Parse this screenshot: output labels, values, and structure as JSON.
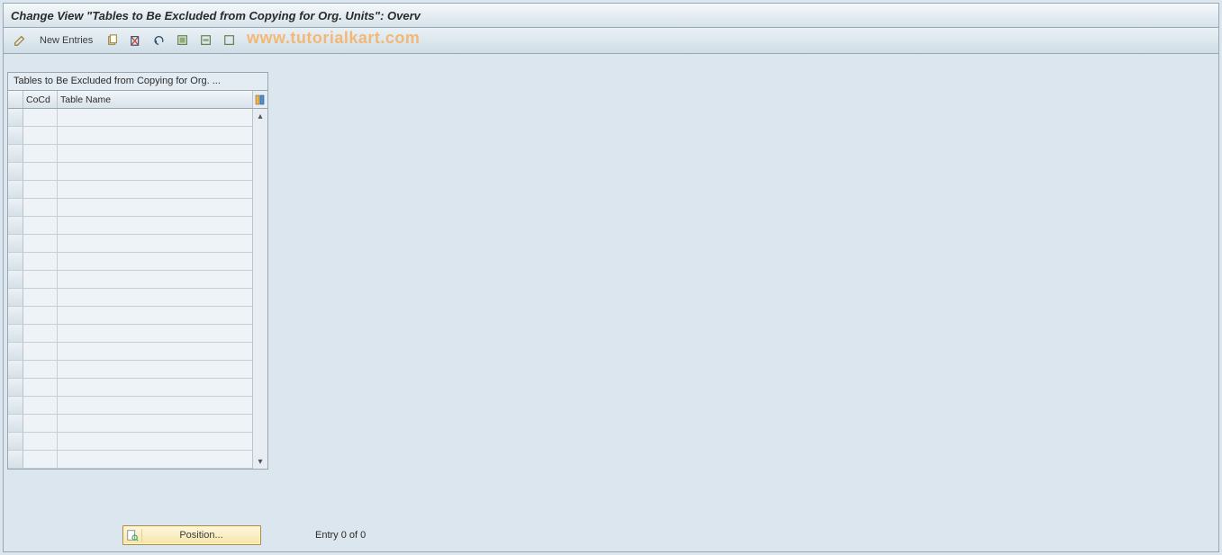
{
  "window": {
    "title": "Change View \"Tables to Be Excluded from Copying for Org. Units\": Overv"
  },
  "toolbar": {
    "display_change_tooltip": "Display/Change",
    "new_entries_label": "New Entries",
    "copy_tooltip": "Copy As...",
    "delete_tooltip": "Delete",
    "undo_tooltip": "Undo Change",
    "select_all_tooltip": "Select All",
    "select_block_tooltip": "Select Block",
    "deselect_all_tooltip": "Deselect All"
  },
  "watermark": "www.tutorialkart.com",
  "grid": {
    "caption": "Tables to Be Excluded from Copying for Org. ...",
    "columns": {
      "selector": "",
      "cocd": "CoCd",
      "table_name": "Table Name",
      "configure_tooltip": "Configure"
    },
    "rows": [
      {
        "cocd": "",
        "table_name": ""
      },
      {
        "cocd": "",
        "table_name": ""
      },
      {
        "cocd": "",
        "table_name": ""
      },
      {
        "cocd": "",
        "table_name": ""
      },
      {
        "cocd": "",
        "table_name": ""
      },
      {
        "cocd": "",
        "table_name": ""
      },
      {
        "cocd": "",
        "table_name": ""
      },
      {
        "cocd": "",
        "table_name": ""
      },
      {
        "cocd": "",
        "table_name": ""
      },
      {
        "cocd": "",
        "table_name": ""
      },
      {
        "cocd": "",
        "table_name": ""
      },
      {
        "cocd": "",
        "table_name": ""
      },
      {
        "cocd": "",
        "table_name": ""
      },
      {
        "cocd": "",
        "table_name": ""
      },
      {
        "cocd": "",
        "table_name": ""
      },
      {
        "cocd": "",
        "table_name": ""
      },
      {
        "cocd": "",
        "table_name": ""
      },
      {
        "cocd": "",
        "table_name": ""
      },
      {
        "cocd": "",
        "table_name": ""
      },
      {
        "cocd": "",
        "table_name": ""
      }
    ]
  },
  "footer": {
    "position_label": "Position...",
    "entry_text": "Entry 0 of 0"
  }
}
